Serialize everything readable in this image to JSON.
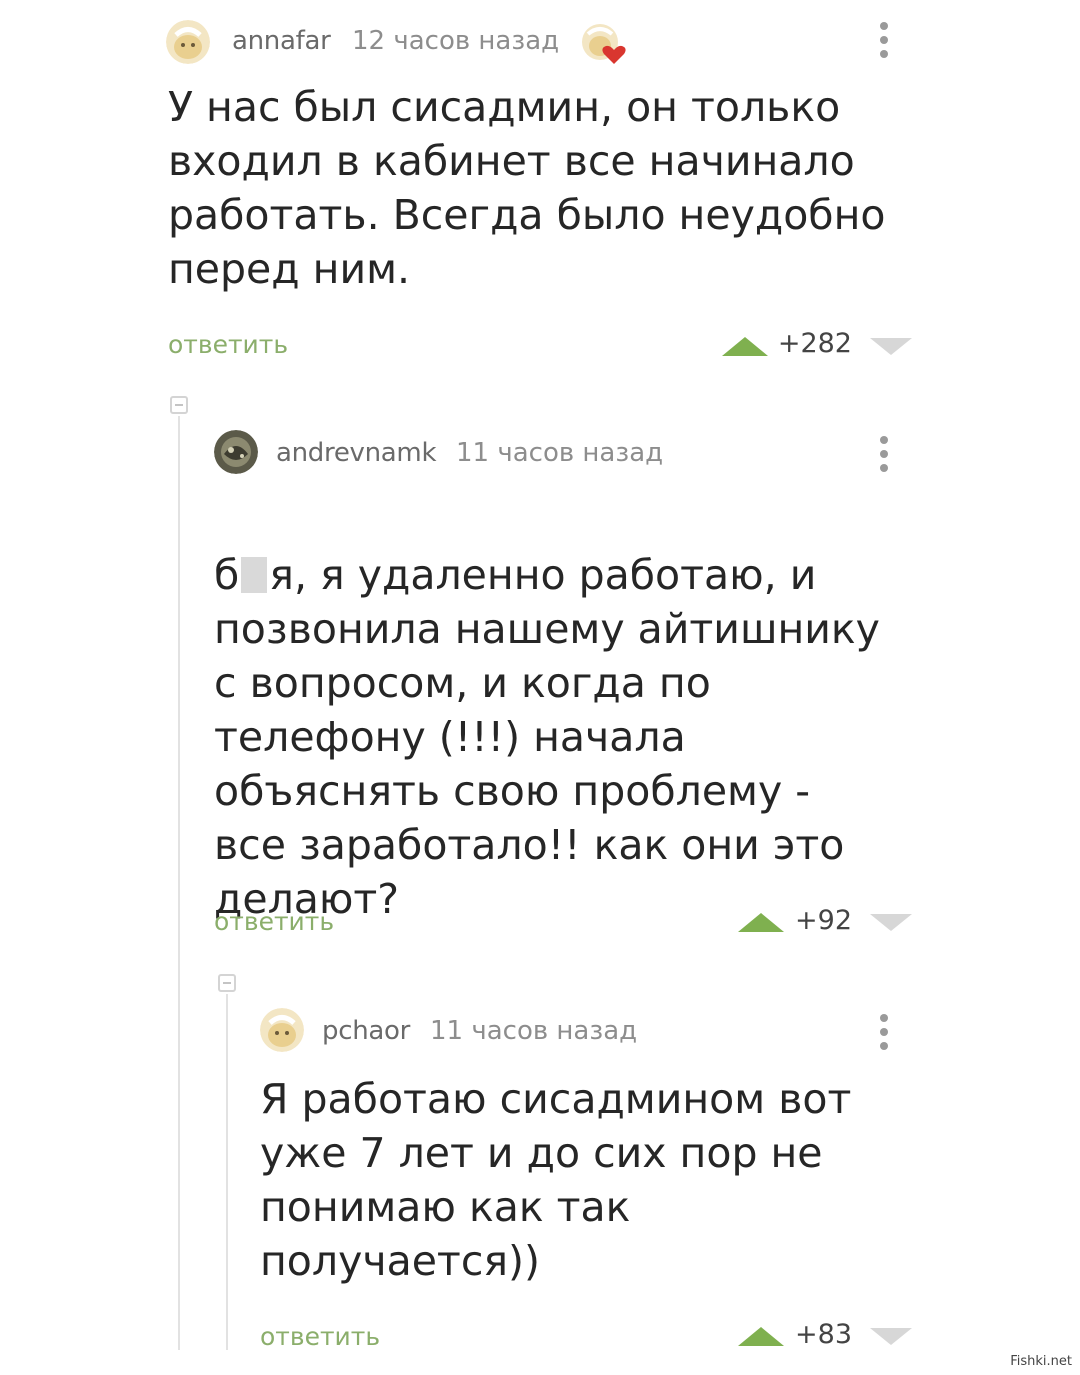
{
  "comments": [
    {
      "username": "annafar",
      "time": "12 часов назад",
      "text": "У нас был сисадмин, он только\nвходил в кабинет все начинало\nработать. Всегда было неудобно\nперед ним.",
      "reply_label": "ответить",
      "score": "+282"
    },
    {
      "username": "andrevnamk",
      "time": "11 часов назад",
      "text_prefix": "б",
      "text_after_blur": "я, я удаленно работаю, и",
      "text_rest": "позвонила нашему айтишнику\nс вопросом, и когда по\nтелефону (!!!) начала\nобъяснять свою проблему -\nвсе заработало!! как они это\nделают?",
      "reply_label": "ответить",
      "score": "+92"
    },
    {
      "username": "pchaor",
      "time": "11 часов назад",
      "text": "Я работаю сисадмином вот\nуже 7 лет и до сих пор не\nпонимаю как так\nполучается))",
      "reply_label": "ответить",
      "score": "+83"
    }
  ],
  "watermark": "Fishki.net",
  "colors": {
    "reply": "#8bae6b",
    "upvote": "#7fb04f",
    "downvote": "#d7d7d7"
  },
  "icons": {
    "upvote": "triangle-up-icon",
    "downvote": "triangle-down-icon",
    "menu": "more-vertical-icon",
    "collapse": "collapse-minus-icon",
    "badge": "heart-badge-icon"
  }
}
